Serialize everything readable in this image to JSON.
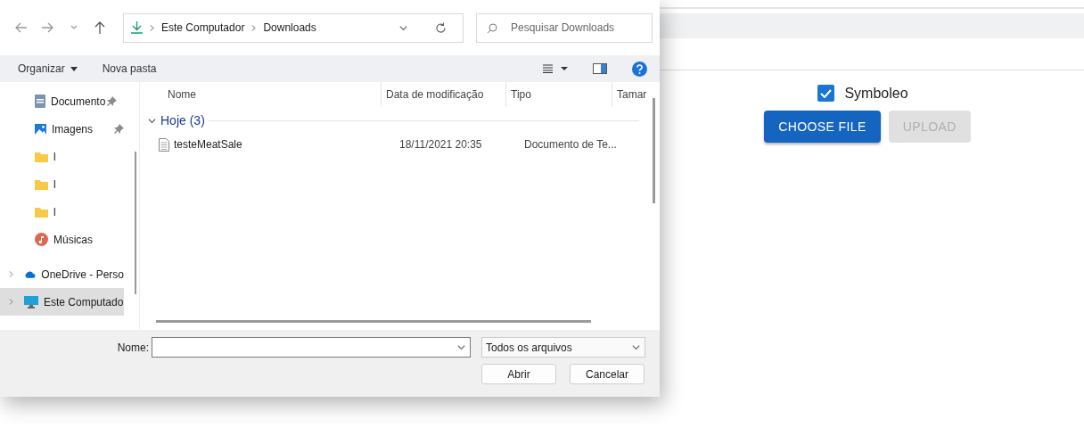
{
  "app": {
    "options": [
      {
        "label": "Symboleo",
        "checked": true
      }
    ],
    "buttons": [
      {
        "label": "CHOOSE FILE",
        "disabled": false
      },
      {
        "label": "UPLOAD",
        "disabled": true
      }
    ]
  },
  "dialog": {
    "address": {
      "path": [
        "Este Computador",
        "Downloads"
      ]
    },
    "search": {
      "placeholder": "Pesquisar Downloads"
    },
    "toolbar": {
      "organize": "Organizar",
      "new_folder": "Nova pasta"
    },
    "sidebar": {
      "items": [
        {
          "label": "Documento",
          "kind": "document",
          "pinned": true
        },
        {
          "label": "Imagens",
          "kind": "pictures",
          "pinned": true
        },
        {
          "label": "l",
          "kind": "folder",
          "pinned": false
        },
        {
          "label": "l",
          "kind": "folder",
          "pinned": false
        },
        {
          "label": "l",
          "kind": "folder",
          "pinned": false
        },
        {
          "label": "Músicas",
          "kind": "music",
          "pinned": false
        },
        {
          "label": "OneDrive - Perso",
          "kind": "cloud",
          "pinned": false,
          "expanded": false,
          "selected": false
        },
        {
          "label": "Este Computado",
          "kind": "computer",
          "pinned": false,
          "expanded": false,
          "selected": true
        }
      ]
    },
    "columns": [
      "Nome",
      "Data de modificação",
      "Tipo",
      "Tamar"
    ],
    "groups": [
      {
        "label": "Hoje (3)",
        "expanded": true,
        "rows": [
          {
            "name": "testeMeatSale",
            "modified": "18/11/2021 20:35",
            "type": "Documento de Te..."
          }
        ]
      }
    ],
    "filename": {
      "label": "Nome:"
    },
    "filter": {
      "value": "Todos os arquivos"
    },
    "buttons": [
      "Abrir",
      "Cancelar"
    ]
  }
}
